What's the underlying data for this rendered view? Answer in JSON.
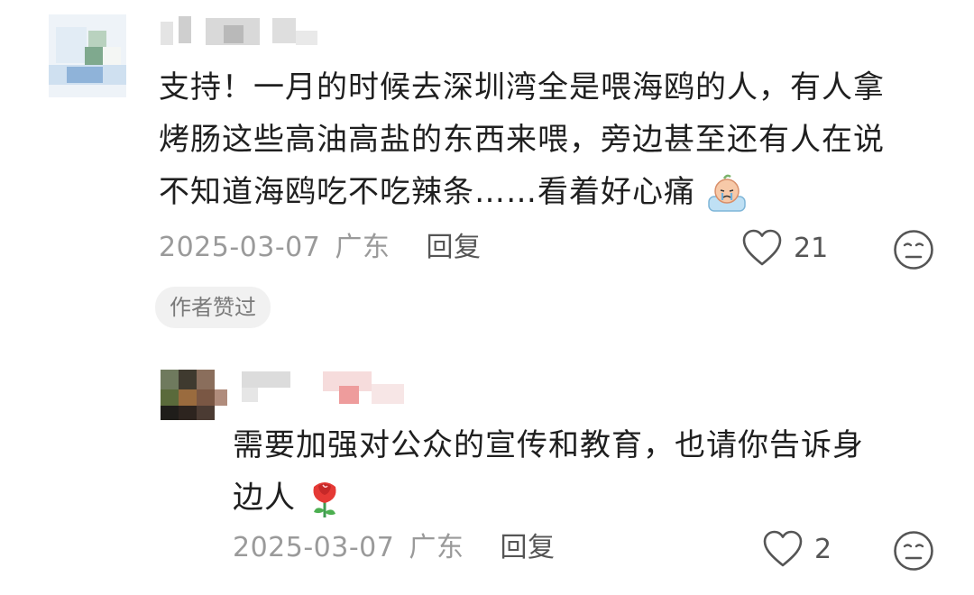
{
  "comments": [
    {
      "text_line1": "支持！一月的时候去深圳湾全是喂海鸥的人，有人拿",
      "text_line2": "烤肠这些高油高盐的东西来喂，旁边甚至还有人在说",
      "text_line3": "不知道海鸥吃不吃辣条……看着好心痛",
      "emoji": "crying-face-emoji",
      "date": "2025-03-07",
      "location": "广东",
      "reply_label": "回复",
      "like_count": "21",
      "badge": "作者赞过"
    },
    {
      "text_line1": "需要加强对公众的宣传和教育，也请你告诉身",
      "text_line2": "边人",
      "emoji": "rose-emoji",
      "date": "2025-03-07",
      "location": "广东",
      "reply_label": "回复",
      "like_count": "2"
    }
  ],
  "icons": {
    "like": "heart-outline-icon",
    "reaction": "neutral-face-icon"
  },
  "colors": {
    "text": "#1f1f1f",
    "meta": "#9a9a9a",
    "badge_bg": "#f1f1f1"
  }
}
